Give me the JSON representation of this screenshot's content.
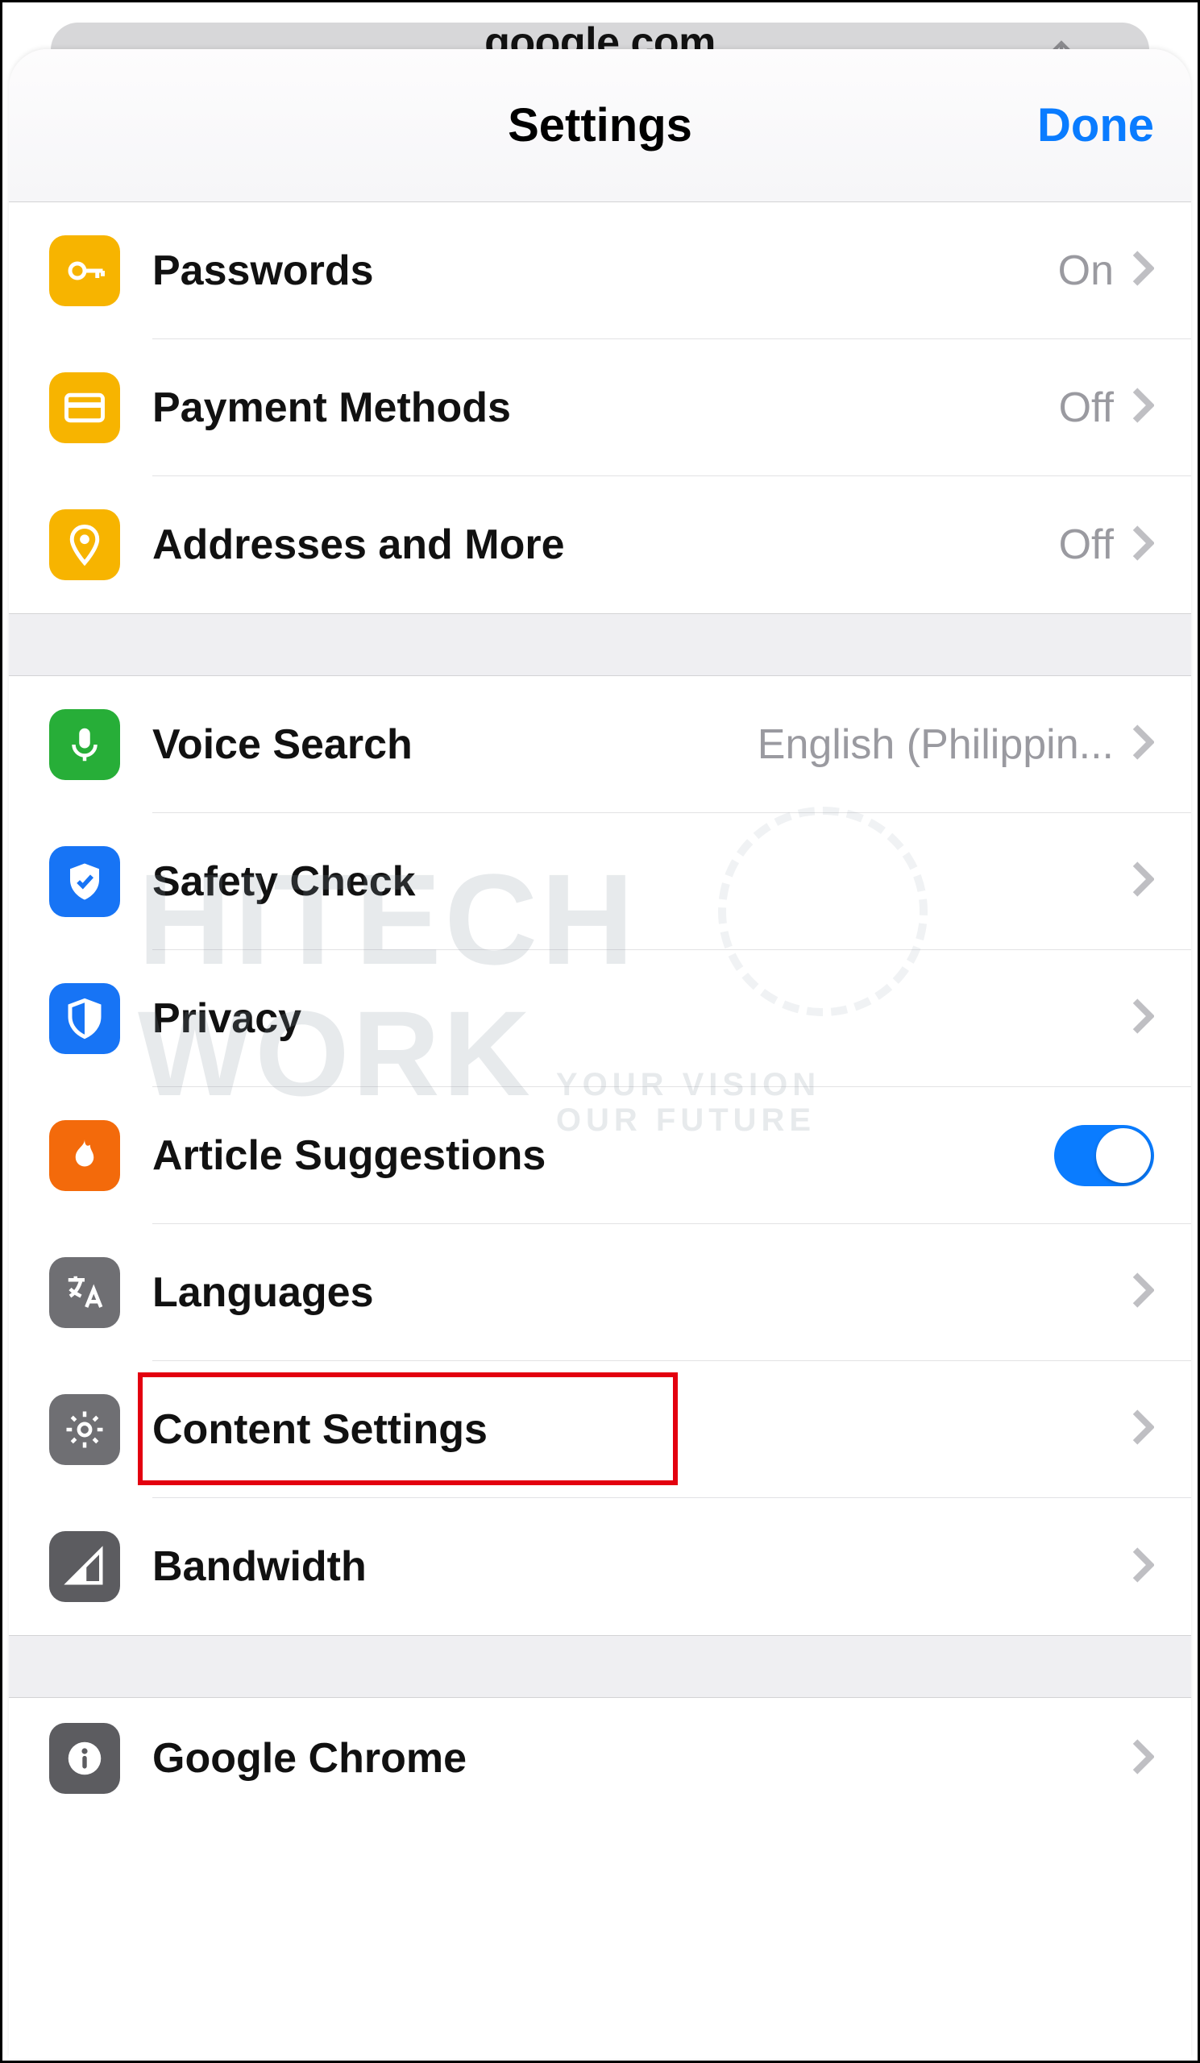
{
  "backdrop": {
    "url_text": "google.com"
  },
  "header": {
    "title": "Settings",
    "done": "Done"
  },
  "groups": {
    "autofill": [
      {
        "name": "passwords",
        "label": "Passwords",
        "value": "On",
        "icon": "key-icon",
        "iconClass": "c-amber",
        "kind": "nav"
      },
      {
        "name": "payment-methods",
        "label": "Payment Methods",
        "value": "Off",
        "icon": "credit-card-icon",
        "iconClass": "c-amber",
        "kind": "nav"
      },
      {
        "name": "addresses",
        "label": "Addresses and More",
        "value": "Off",
        "icon": "pin-icon",
        "iconClass": "c-amber",
        "kind": "nav"
      }
    ],
    "main": [
      {
        "name": "voice-search",
        "label": "Voice Search",
        "value": "English (Philippin...",
        "icon": "mic-icon",
        "iconClass": "c-green",
        "kind": "nav"
      },
      {
        "name": "safety-check",
        "label": "Safety Check",
        "value": "",
        "icon": "shield-check-icon",
        "iconClass": "c-blue",
        "kind": "nav"
      },
      {
        "name": "privacy",
        "label": "Privacy",
        "value": "",
        "icon": "shield-half-icon",
        "iconClass": "c-blue",
        "kind": "nav"
      },
      {
        "name": "article-suggestions",
        "label": "Article Suggestions",
        "value": "",
        "icon": "flame-icon",
        "iconClass": "c-orange",
        "kind": "toggle",
        "on": true
      },
      {
        "name": "languages",
        "label": "Languages",
        "value": "",
        "icon": "translate-icon",
        "iconClass": "c-gray",
        "kind": "nav"
      },
      {
        "name": "content-settings",
        "label": "Content Settings",
        "value": "",
        "icon": "gear-icon",
        "iconClass": "c-gray",
        "kind": "nav",
        "highlighted": true
      },
      {
        "name": "bandwidth",
        "label": "Bandwidth",
        "value": "",
        "icon": "signal-icon",
        "iconClass": "c-gray2",
        "kind": "nav"
      }
    ],
    "about": [
      {
        "name": "google-chrome",
        "label": "Google Chrome",
        "value": "",
        "icon": "info-icon",
        "iconClass": "c-gray2",
        "kind": "nav"
      }
    ]
  },
  "watermark": {
    "line1": "HITECH",
    "line2": "WORK",
    "tag1": "YOUR VISION",
    "tag2": "OUR FUTURE"
  }
}
